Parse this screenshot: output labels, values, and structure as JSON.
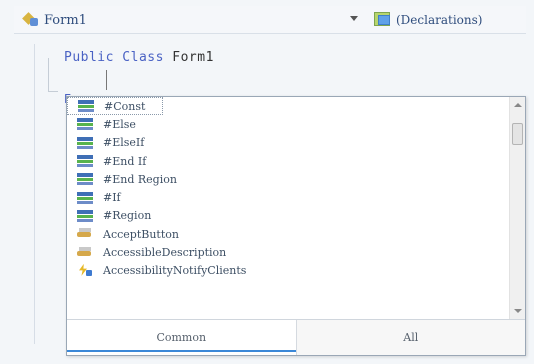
{
  "toolbar": {
    "class_dropdown": "Form1",
    "members_dropdown": "(Declarations)",
    "class_icon": "class-icon",
    "members_icon": "declarations-icon"
  },
  "code": {
    "keyword_public": "Public",
    "keyword_class": "Class",
    "class_name": "Form1",
    "partial_end": "E"
  },
  "completion": {
    "items": [
      {
        "label": "#Const",
        "icon": "snippet-icon"
      },
      {
        "label": "#Else",
        "icon": "snippet-icon"
      },
      {
        "label": "#ElseIf",
        "icon": "snippet-icon"
      },
      {
        "label": "#End If",
        "icon": "snippet-icon"
      },
      {
        "label": "#End Region",
        "icon": "snippet-icon"
      },
      {
        "label": "#If",
        "icon": "snippet-icon"
      },
      {
        "label": "#Region",
        "icon": "snippet-icon"
      },
      {
        "label": "AcceptButton",
        "icon": "property-icon"
      },
      {
        "label": "AccessibleDescription",
        "icon": "property-icon"
      },
      {
        "label": "AccessibilityNotifyClients",
        "icon": "event-icon"
      }
    ],
    "tabs": {
      "common": "Common",
      "all": "All"
    }
  },
  "colors": {
    "keyword": "#4a62c4",
    "selection_underline": "#3b88d8"
  }
}
